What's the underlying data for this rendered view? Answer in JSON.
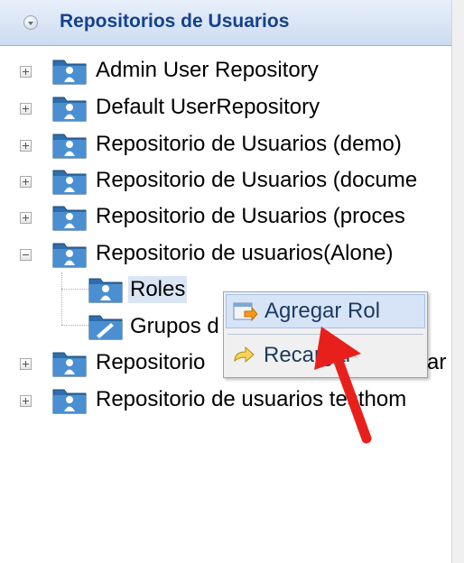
{
  "panel": {
    "title": "Repositorios de Usuarios"
  },
  "tree": {
    "nodes": [
      {
        "label": "Admin User Repository",
        "expander": "plus"
      },
      {
        "label": "Default UserRepository",
        "expander": "plus"
      },
      {
        "label": "Repositorio de Usuarios (demo)",
        "expander": "plus"
      },
      {
        "label": "Repositorio de Usuarios (docume",
        "expander": "plus"
      },
      {
        "label": "Repositorio de Usuarios (proces",
        "expander": "plus"
      },
      {
        "label": "Repositorio de usuarios(Alone)",
        "expander": "minus"
      },
      {
        "label": "Repositorio",
        "expander": "plus",
        "suffix": "ar"
      },
      {
        "label": "Repositorio de usuarios testhom",
        "expander": "plus"
      }
    ],
    "children": [
      {
        "label": "Roles",
        "selected": true
      },
      {
        "label": "Grupos d"
      }
    ]
  },
  "context_menu": {
    "items": [
      {
        "label": "Agregar Rol",
        "icon": "add-role-icon"
      },
      {
        "label": "Recargar",
        "icon": "reload-icon"
      }
    ]
  },
  "annotation": {
    "arrow_color": "#e8201c"
  }
}
